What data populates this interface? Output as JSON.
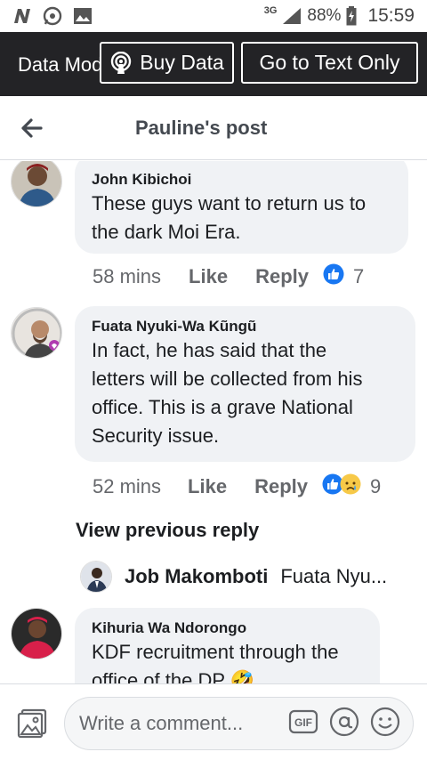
{
  "status_bar": {
    "network": "3G",
    "battery": "88%",
    "time": "15:59"
  },
  "data_bar": {
    "data_mode_label": "Data Mode",
    "buy_data_label": "Buy Data",
    "text_only_label": "Go to Text Only"
  },
  "header": {
    "title": "Pauline's post"
  },
  "comments": [
    {
      "author": "John Kibichoi",
      "text_lines": [
        "These guys want to return us to",
        "the dark Moi Era."
      ],
      "time": "58 mins",
      "like_label": "Like",
      "reply_label": "Reply",
      "reactions": [
        "like"
      ],
      "reaction_count": "7"
    },
    {
      "author": "Fuata Nyuki-Wa Kũngũ",
      "text_lines": [
        "In fact, he has said that the",
        "letters will be collected from his",
        "office. This is a grave  National",
        "Security issue."
      ],
      "time": "52 mins",
      "like_label": "Like",
      "reply_label": "Reply",
      "reactions": [
        "like",
        "sad"
      ],
      "reaction_count": "9"
    },
    {
      "author": "Kihuria Wa Ndorongo",
      "text_lines": [
        "KDF recruitment through the",
        "office of the DP 🤣"
      ]
    }
  ],
  "view_previous_reply": "View previous reply",
  "nested_reply": {
    "author": "Job Makomboti",
    "preview": "Fuata Nyu..."
  },
  "composer": {
    "placeholder": "Write a comment...",
    "gif_label": "GIF"
  },
  "colors": {
    "like_blue": "#1877f2",
    "bubble_bg": "#f0f2f5",
    "bar_dark": "#232326"
  }
}
